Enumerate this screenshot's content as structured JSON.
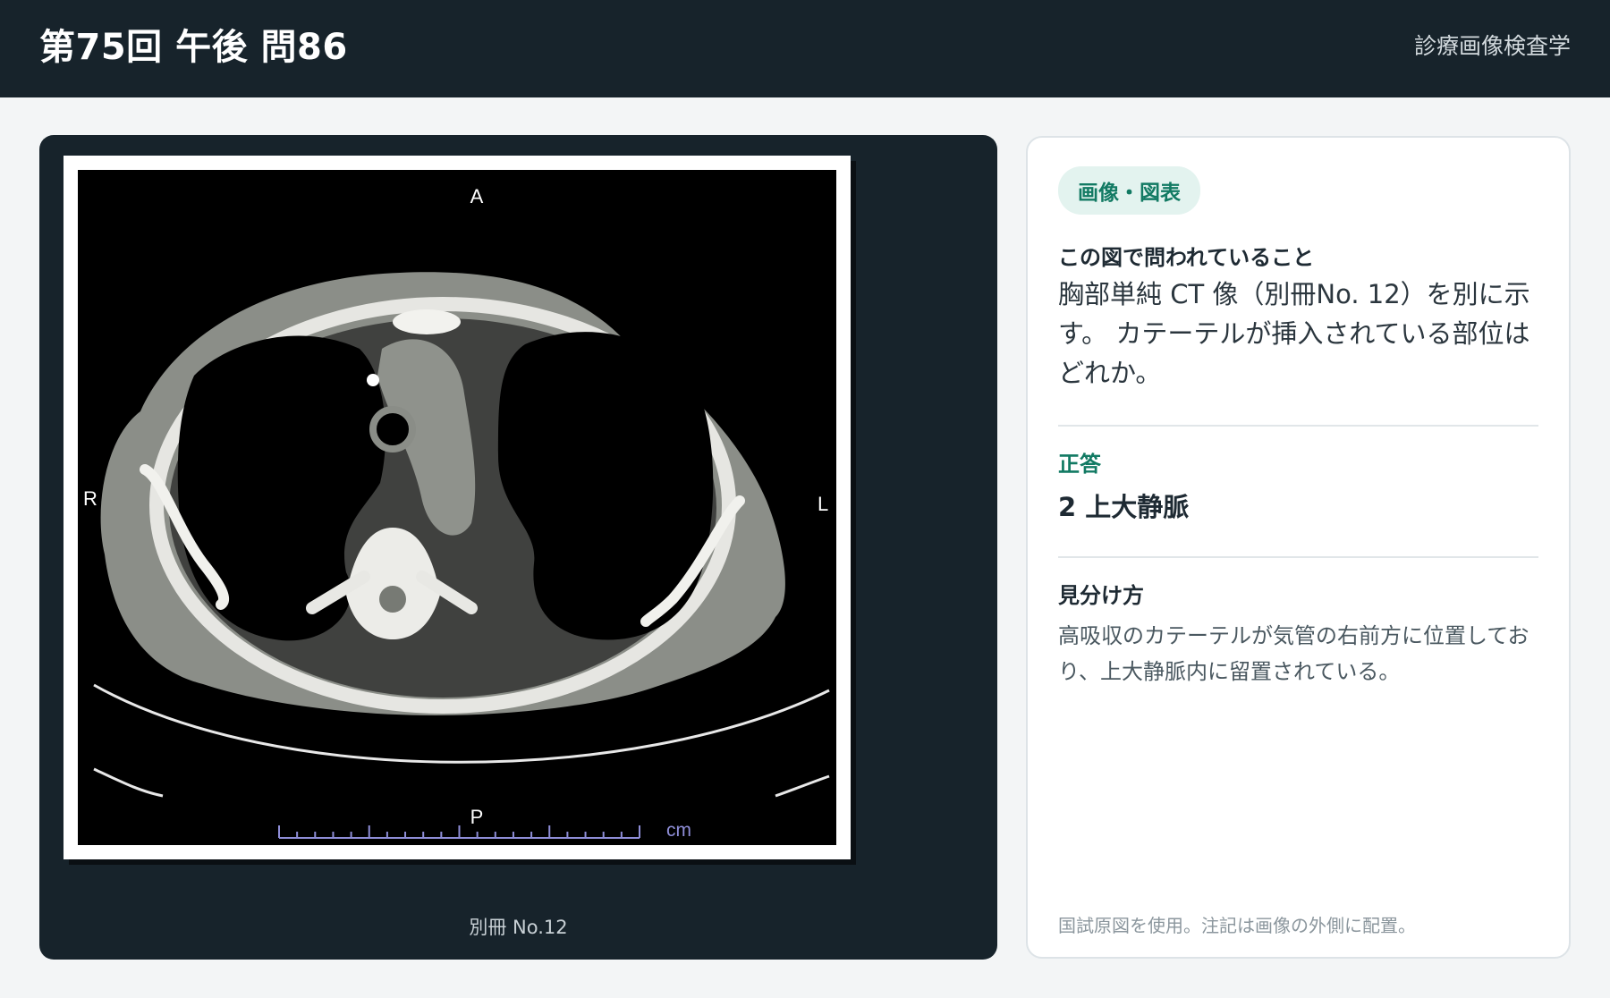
{
  "header": {
    "title": "第75回 午後 問86",
    "subject": "診療画像検査学"
  },
  "image_panel": {
    "orientation": {
      "anterior": "A",
      "posterior": "P",
      "right": "R",
      "left": "L"
    },
    "scale_unit": "cm",
    "caption": "別冊 No.12"
  },
  "info": {
    "badge": "画像・図表",
    "question_label": "この図で問われていること",
    "question": "胸部単純 CT 像（別冊No. 12）を別に示す。 カテーテルが挿入されている部位はどれか。",
    "answer_label": "正答",
    "answer": "2 上大静脈",
    "explain_label": "見分け方",
    "explanation": "高吸収のカテーテルが気管の右前方に位置しており、上大静脈内に留置されている。",
    "footnote": "国試原図を使用。注記は画像の外側に配置。"
  }
}
